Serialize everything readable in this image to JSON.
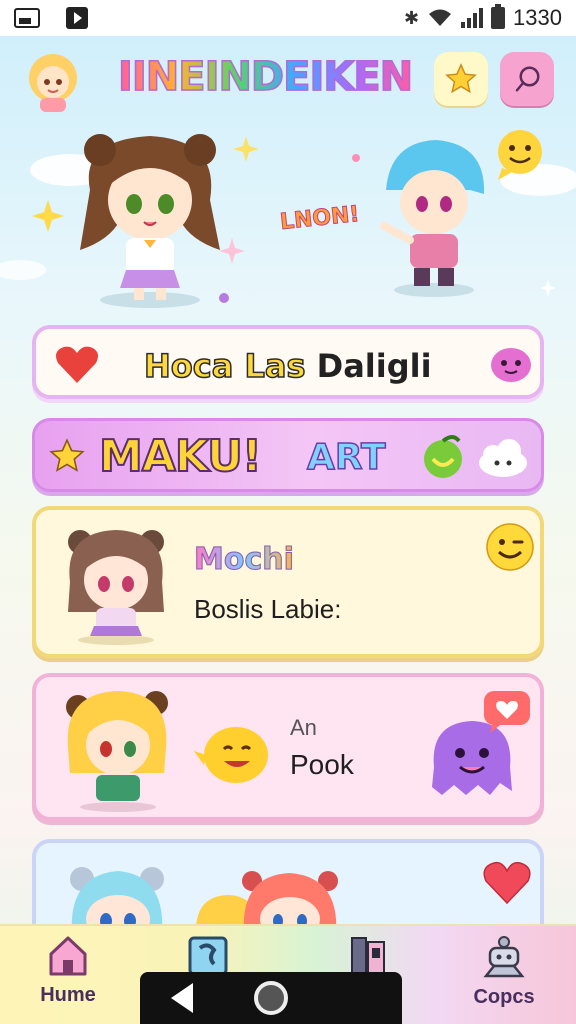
{
  "status_bar": {
    "time": "1330",
    "icons": [
      "image-icon",
      "play-store-icon",
      "mute-icon",
      "wifi-icon",
      "signal-icon",
      "battery-icon"
    ]
  },
  "header": {
    "app_title": "IINEINDEIKEN",
    "star_icon": "star-icon",
    "chat_icon": "chat-bubble-icon"
  },
  "hero": {
    "shout_text": "LNON!"
  },
  "banners": [
    {
      "text_highlight": "Hoca Las",
      "text_rest": " Daligli"
    },
    {
      "title": "MAKU!",
      "subtitle": "ART"
    }
  ],
  "cards": [
    {
      "title": "Mochi",
      "subtitle": "Boslis Labie:",
      "badge": "smile-emoji-icon"
    },
    {
      "small": "An",
      "title": "Pook",
      "badge": "heart-bubble-icon"
    },
    {
      "badge": "heart-icon"
    }
  ],
  "bottom_nav": {
    "items": [
      {
        "label": "Hume",
        "icon": "home-icon"
      },
      {
        "label": "",
        "icon": "puzzle-icon"
      },
      {
        "label": "",
        "icon": "book-icon"
      },
      {
        "label": "Copcs",
        "icon": "robot-icon"
      }
    ]
  },
  "colors": {
    "accent_pink": "#f6a3cf",
    "accent_yellow": "#ffd83b",
    "banner_purple": "#e7a1ef",
    "card_yellow": "#fff8dc",
    "card_pink": "#ffe4f1",
    "card_blue": "#e6f4ff"
  }
}
